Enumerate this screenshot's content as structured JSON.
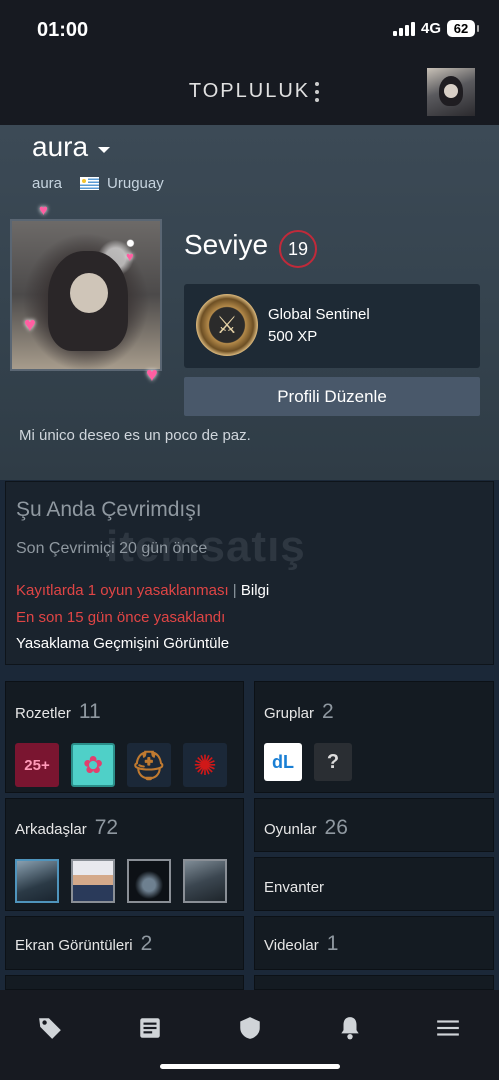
{
  "status_bar": {
    "time": "01:00",
    "network": "4G",
    "battery": "62"
  },
  "header": {
    "title": "TOPLULUK"
  },
  "profile": {
    "name": "aura",
    "real_name": "aura",
    "country": "Uruguay",
    "level_label": "Seviye",
    "level": "19",
    "featured_badge": {
      "name": "Global Sentinel",
      "xp": "500 XP"
    },
    "edit_button": "Profili Düzenle",
    "summary": "Mi único deseo es un poco de paz."
  },
  "status": {
    "title": "Şu Anda Çevrimdışı",
    "last_online": "Son Çevrimiçi 20 gün önce",
    "ban_record": "Kayıtlarda 1 oyun yasaklanması",
    "ban_separator": "|",
    "ban_info": "Bilgi",
    "last_ban": "En son 15 gün önce yasaklandı",
    "ban_history_link": "Yasaklama Geçmişini Görüntüle",
    "watermark": "itemsatış"
  },
  "sections": {
    "badges": {
      "label": "Rozetler",
      "count": "11",
      "badge1_text": "25+"
    },
    "groups": {
      "label": "Gruplar",
      "count": "2",
      "group1_text": "dL",
      "group2_text": "?"
    },
    "friends": {
      "label": "Arkadaşlar",
      "count": "72"
    },
    "games": {
      "label": "Oyunlar",
      "count": "26"
    },
    "inventory": {
      "label": "Envanter"
    },
    "screenshots": {
      "label": "Ekran Görüntüleri",
      "count": "2"
    },
    "videos": {
      "label": "Videolar",
      "count": "1"
    }
  },
  "colors": {
    "accent_level": "#c02a3a",
    "ban_red": "#e04545",
    "friend_border": "#4f94bc"
  },
  "icons": {
    "bottom_nav": [
      "tag-icon",
      "news-icon",
      "shield-icon",
      "bell-icon",
      "menu-icon"
    ]
  }
}
